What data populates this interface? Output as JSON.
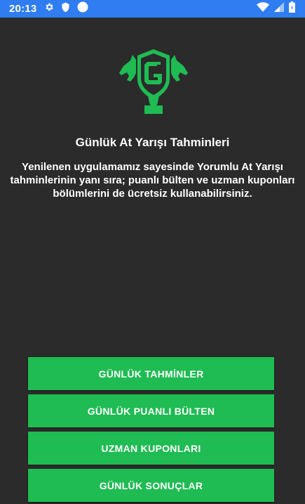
{
  "status_bar": {
    "time": "20:13",
    "left_icons": [
      "gear-icon",
      "shield-icon",
      "circle-icon"
    ],
    "right_icons": [
      "wifi-icon",
      "signal-icon",
      "battery-icon"
    ],
    "color": "#2f7df1"
  },
  "app": {
    "title": "Günlük At Yarışı Tahminleri",
    "description": "Yenilenen uygulamamız sayesinde Yorumlu At Yarışı tahminlerinin yanı sıra; puanlı bülten ve uzman kuponları bölümlerini de ücretsiz kullanabilirsiniz.",
    "logo_letter": "G",
    "accent_color": "#1fbb53",
    "background_color": "#2b2b2b"
  },
  "buttons": [
    {
      "label": "GÜNLÜK TAHMİNLER"
    },
    {
      "label": "GÜNLÜK PUANLI BÜLTEN"
    },
    {
      "label": "UZMAN KUPONLARI"
    },
    {
      "label": "GÜNLÜK SONUÇLAR"
    }
  ]
}
